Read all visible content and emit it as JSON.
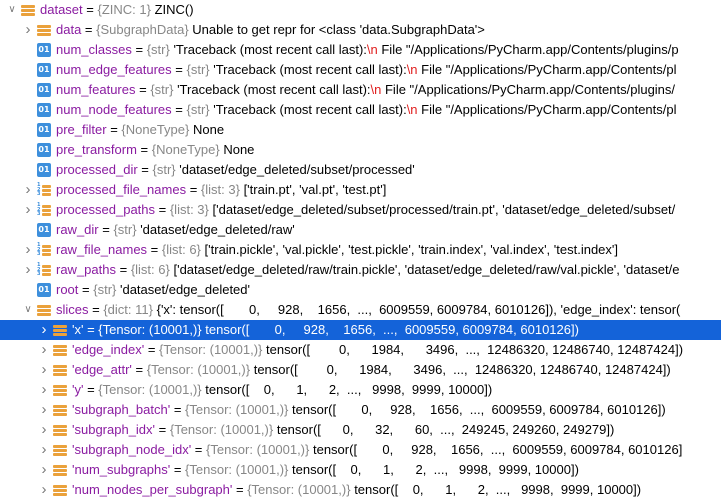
{
  "rows": [
    {
      "indent": 0,
      "arrow": "open",
      "icon": "stack",
      "name": "dataset",
      "type": "{ZINC: 1}",
      "value": "ZINC()"
    },
    {
      "indent": 1,
      "arrow": "closed",
      "icon": "stack",
      "name": "data",
      "type": "{SubgraphData}",
      "value": "Unable to get repr for <class 'data.SubgraphData'>"
    },
    {
      "indent": 1,
      "arrow": "none",
      "icon": "var",
      "name": "num_classes",
      "type": "{str}",
      "value": "'Traceback (most recent call last):",
      "esc": "\\n",
      "tail": " File \"/Applications/PyCharm.app/Contents/plugins/p"
    },
    {
      "indent": 1,
      "arrow": "none",
      "icon": "var",
      "name": "num_edge_features",
      "type": "{str}",
      "value": "'Traceback (most recent call last):",
      "esc": "\\n",
      "tail": " File \"/Applications/PyCharm.app/Contents/pl"
    },
    {
      "indent": 1,
      "arrow": "none",
      "icon": "var",
      "name": "num_features",
      "type": "{str}",
      "value": "'Traceback (most recent call last):",
      "esc": "\\n",
      "tail": " File \"/Applications/PyCharm.app/Contents/plugins/"
    },
    {
      "indent": 1,
      "arrow": "none",
      "icon": "var",
      "name": "num_node_features",
      "type": "{str}",
      "value": "'Traceback (most recent call last):",
      "esc": "\\n",
      "tail": " File \"/Applications/PyCharm.app/Contents/pl"
    },
    {
      "indent": 1,
      "arrow": "none",
      "icon": "var",
      "name": "pre_filter",
      "type": "{NoneType}",
      "value": "None"
    },
    {
      "indent": 1,
      "arrow": "none",
      "icon": "var",
      "name": "pre_transform",
      "type": "{NoneType}",
      "value": "None"
    },
    {
      "indent": 1,
      "arrow": "none",
      "icon": "var",
      "name": "processed_dir",
      "type": "{str}",
      "value": "'dataset/edge_deleted/subset/processed'"
    },
    {
      "indent": 1,
      "arrow": "closed",
      "icon": "listn",
      "name": "processed_file_names",
      "type": "{list: 3}",
      "value": "['train.pt', 'val.pt', 'test.pt']"
    },
    {
      "indent": 1,
      "arrow": "closed",
      "icon": "listn",
      "name": "processed_paths",
      "type": "{list: 3}",
      "value": "['dataset/edge_deleted/subset/processed/train.pt', 'dataset/edge_deleted/subset/"
    },
    {
      "indent": 1,
      "arrow": "none",
      "icon": "var",
      "name": "raw_dir",
      "type": "{str}",
      "value": "'dataset/edge_deleted/raw'"
    },
    {
      "indent": 1,
      "arrow": "closed",
      "icon": "listn",
      "name": "raw_file_names",
      "type": "{list: 6}",
      "value": "['train.pickle', 'val.pickle', 'test.pickle', 'train.index', 'val.index', 'test.index']"
    },
    {
      "indent": 1,
      "arrow": "closed",
      "icon": "listn",
      "name": "raw_paths",
      "type": "{list: 6}",
      "value": "['dataset/edge_deleted/raw/train.pickle', 'dataset/edge_deleted/raw/val.pickle', 'dataset/e"
    },
    {
      "indent": 1,
      "arrow": "none",
      "icon": "var",
      "name": "root",
      "type": "{str}",
      "value": "'dataset/edge_deleted'"
    },
    {
      "indent": 1,
      "arrow": "open",
      "icon": "stack",
      "name": "slices",
      "type": "{dict: 11}",
      "value": "{'x': tensor([       0,     928,    1656,  ...,  6009559, 6009784, 6010126]), 'edge_index': tensor("
    },
    {
      "indent": 2,
      "arrow": "closed",
      "icon": "stack",
      "name": "'x'",
      "type": "{Tensor: (10001,)}",
      "value": "tensor([       0,     928,    1656,  ...,  6009559, 6009784, 6010126])",
      "selected": true
    },
    {
      "indent": 2,
      "arrow": "closed",
      "icon": "stack",
      "name": "'edge_index'",
      "type": "{Tensor: (10001,)}",
      "value": "tensor([        0,      1984,      3496,  ...,  12486320, 12486740, 12487424])"
    },
    {
      "indent": 2,
      "arrow": "closed",
      "icon": "stack",
      "name": "'edge_attr'",
      "type": "{Tensor: (10001,)}",
      "value": "tensor([        0,      1984,      3496,  ...,  12486320, 12486740, 12487424])"
    },
    {
      "indent": 2,
      "arrow": "closed",
      "icon": "stack",
      "name": "'y'",
      "type": "{Tensor: (10001,)}",
      "value": "tensor([    0,      1,      2,  ...,   9998,  9999, 10000])"
    },
    {
      "indent": 2,
      "arrow": "closed",
      "icon": "stack",
      "name": "'subgraph_batch'",
      "type": "{Tensor: (10001,)}",
      "value": "tensor([       0,     928,    1656,  ...,  6009559, 6009784, 6010126])"
    },
    {
      "indent": 2,
      "arrow": "closed",
      "icon": "stack",
      "name": "'subgraph_idx'",
      "type": "{Tensor: (10001,)}",
      "value": "tensor([      0,      32,      60,  ...,  249245, 249260, 249279])"
    },
    {
      "indent": 2,
      "arrow": "closed",
      "icon": "stack",
      "name": "'subgraph_node_idx'",
      "type": "{Tensor: (10001,)}",
      "value": "tensor([       0,     928,    1656,  ...,  6009559, 6009784, 6010126]"
    },
    {
      "indent": 2,
      "arrow": "closed",
      "icon": "stack",
      "name": "'num_subgraphs'",
      "type": "{Tensor: (10001,)}",
      "value": "tensor([    0,      1,      2,  ...,   9998,  9999, 10000])"
    },
    {
      "indent": 2,
      "arrow": "closed",
      "icon": "stack",
      "name": "'num_nodes_per_subgraph'",
      "type": "{Tensor: (10001,)}",
      "value": "tensor([    0,      1,      2,  ...,   9998,  9999, 10000])"
    }
  ],
  "colors": {
    "selection": "#1463d9",
    "name": "#8a1ba1",
    "type": "#878787",
    "escape": "#e01e1e",
    "icon_blue": "#3d8fdc",
    "icon_orange": "#eaa13b"
  }
}
